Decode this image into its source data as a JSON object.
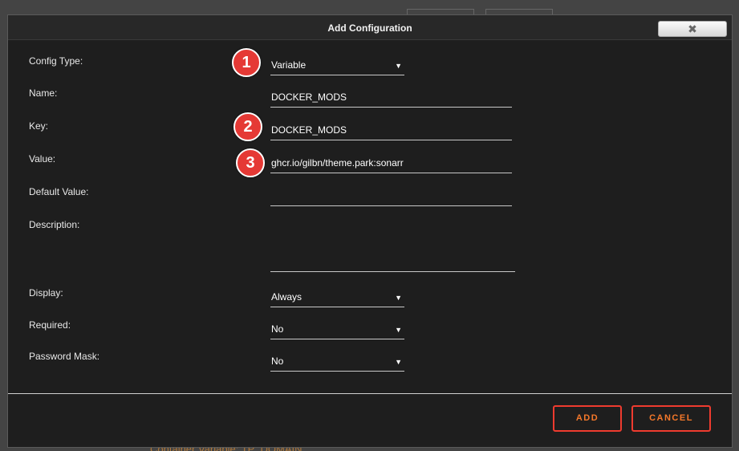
{
  "dialog": {
    "title": "Add Configuration",
    "close_glyph": "✖"
  },
  "background": {
    "partial_text": "Container Variable: TP_DOMAIN"
  },
  "form": {
    "config_type": {
      "label": "Config Type:",
      "value": "Variable"
    },
    "name": {
      "label": "Name:",
      "value": "DOCKER_MODS"
    },
    "key": {
      "label": "Key:",
      "value": "DOCKER_MODS"
    },
    "value": {
      "label": "Value:",
      "value": "ghcr.io/gilbn/theme.park:sonarr"
    },
    "default_value": {
      "label": "Default Value:",
      "value": ""
    },
    "description": {
      "label": "Description:",
      "value": ""
    },
    "display": {
      "label": "Display:",
      "value": "Always"
    },
    "required": {
      "label": "Required:",
      "value": "No"
    },
    "password_mask": {
      "label": "Password Mask:",
      "value": "No"
    }
  },
  "markers": [
    "1",
    "2",
    "3"
  ],
  "buttons": {
    "add": "ADD",
    "cancel": "CANCEL"
  },
  "icons": {
    "dropdown": "caret-down-icon",
    "close": "close-icon"
  },
  "colors": {
    "accent": "#f5782a",
    "button_border": "#ef3b2f",
    "marker": "#e53935",
    "dialog_bg": "#1e1e1e"
  }
}
